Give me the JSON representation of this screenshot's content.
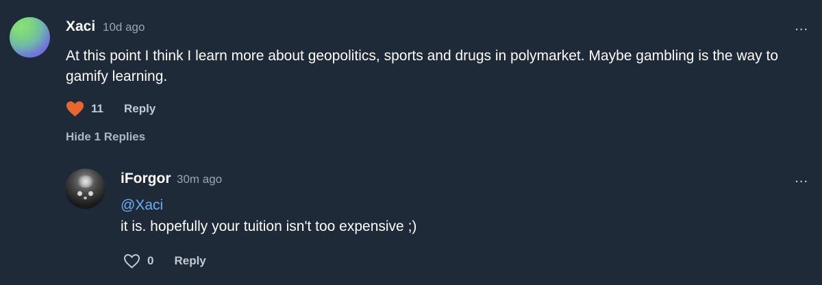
{
  "comment": {
    "username": "Xaci",
    "time": "10d ago",
    "text": "At this point I think I learn more about geopolitics, sports and drugs in polymarket. Maybe gambling is the way to gamify learning.",
    "like_count": "11",
    "reply_label": "Reply",
    "more_label": "...",
    "hide_replies_label": "Hide 1 Replies"
  },
  "reply": {
    "username": "iForgor",
    "time": "30m ago",
    "mention": "@Xaci",
    "text": "it is. hopefully your tuition isn't too expensive ;)",
    "like_count": "0",
    "reply_label": "Reply",
    "more_label": "..."
  },
  "colors": {
    "background": "#1f2a38",
    "text_primary": "#ffffff",
    "text_secondary": "#9aa4b2",
    "mention": "#6aaef5",
    "heart_filled": "#e8672f"
  },
  "icons": {
    "like_filled": "heart-filled-icon",
    "like_outline": "heart-outline-icon",
    "more": "more-options-icon"
  }
}
